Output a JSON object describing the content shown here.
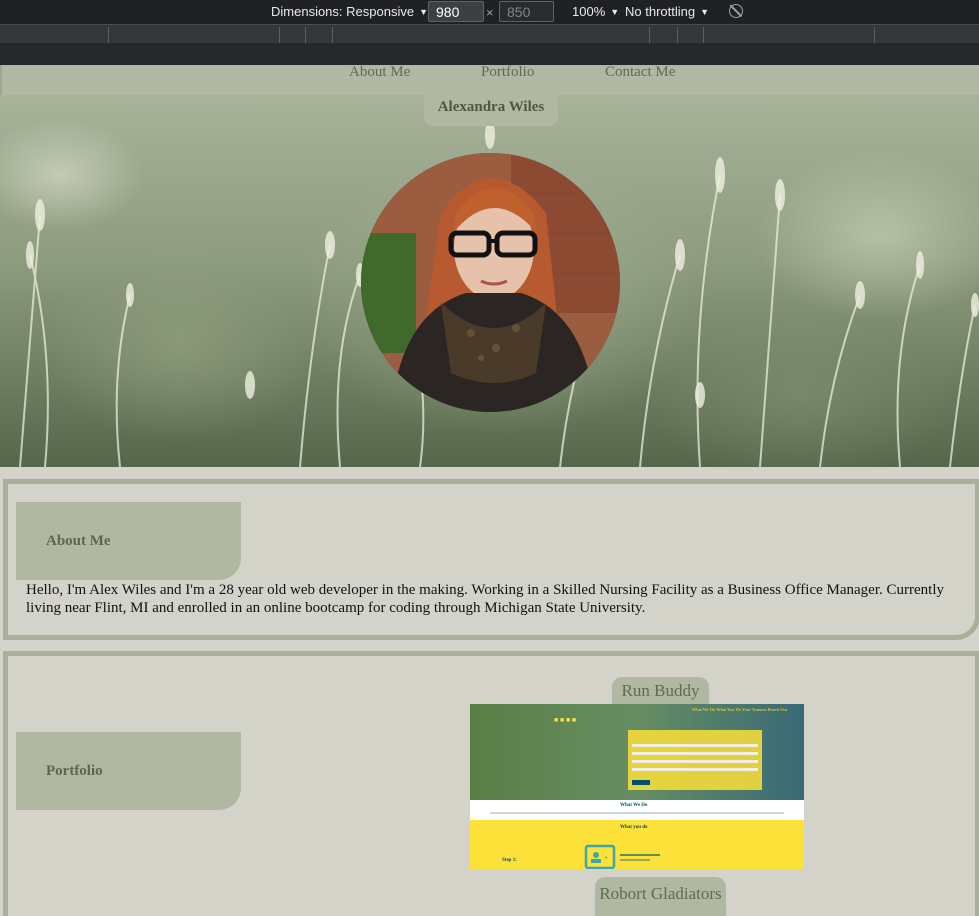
{
  "devtools": {
    "dimensions_label": "Dimensions: Responsive",
    "width_value": "980",
    "height_value": "850",
    "times": "×",
    "zoom": "100%",
    "throttling": "No throttling",
    "rotate_icon": "rotate-icon"
  },
  "nav": {
    "about": "About Me",
    "portfolio": "Portfolio",
    "contact": "Contact Me"
  },
  "hero": {
    "name": "Alexandra Wiles"
  },
  "about": {
    "heading": "About Me",
    "text": "Hello, I'm Alex Wiles and I'm a 28 year old web developer in the making. Working in a Skilled Nursing Facility as a Business Office Manager. Currently living near Flint, MI and enrolled in an online bootcamp for coding through Michigan State University."
  },
  "portfolio": {
    "heading": "Portfolio",
    "projects": [
      {
        "title": "Run Buddy",
        "screenshot": {
          "nav": "What We Do   What You Do   Your Trainers   Reach Out",
          "section1": "What We Do",
          "section2": "What you do",
          "step": "Step 1:"
        }
      },
      {
        "title": "Robort Gladiators"
      }
    ]
  },
  "colors": {
    "nav_bg": "#b1b8a1",
    "page_bg": "#d4d3ca",
    "border": "#a9b09a",
    "runbuddy_yellow": "#fce138",
    "runbuddy_teal": "#024e76"
  }
}
